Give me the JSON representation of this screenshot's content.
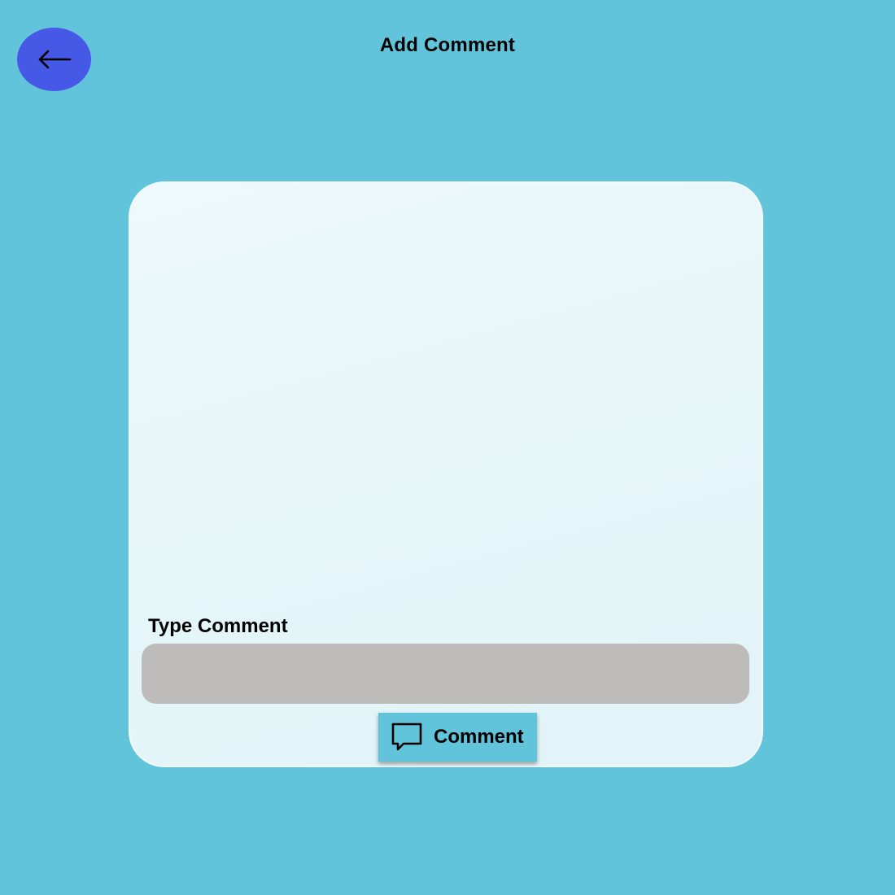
{
  "header": {
    "title": "Add Comment",
    "back_icon": "arrow-left-icon"
  },
  "form": {
    "input_label": "Type Comment",
    "input_value": "",
    "input_placeholder": "",
    "submit_label": "Comment",
    "submit_icon": "speech-bubble-icon"
  },
  "colors": {
    "background": "#62c4db",
    "back_button": "#4658e6",
    "card": "#e6f6f9",
    "input_fill": "#bebbbb",
    "submit_button": "#62c4db"
  }
}
